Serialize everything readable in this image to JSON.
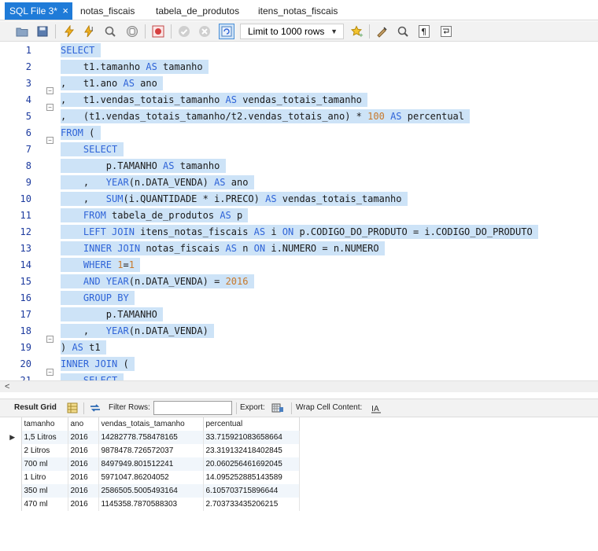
{
  "tabs": [
    {
      "label": "SQL File 3*",
      "close": "×"
    },
    {
      "label": "notas_fiscais"
    },
    {
      "label": "tabela_de_produtos"
    },
    {
      "label": "itens_notas_fiscais"
    }
  ],
  "toolbar": {
    "limit_label": "Limit to 1000 rows"
  },
  "editor": {
    "line_numbers": [
      "1",
      "2",
      "3",
      "4",
      "5",
      "6",
      "7",
      "8",
      "9",
      "10",
      "11",
      "12",
      "13",
      "14",
      "15",
      "16",
      "17",
      "18",
      "19",
      "20",
      "21"
    ]
  },
  "results_toolbar": {
    "result_grid": "Result Grid",
    "filter_rows": "Filter Rows:",
    "filter_value": "",
    "export": "Export:",
    "wrap": "Wrap Cell Content:"
  },
  "results": {
    "columns": [
      "tamanho",
      "ano",
      "vendas_totais_tamanho",
      "percentual"
    ],
    "rows": [
      [
        "1,5 Litros",
        "2016",
        "14282778.758478165",
        "33.715921083658664"
      ],
      [
        "2 Litros",
        "2016",
        "9878478.726572037",
        "23.319132418402845"
      ],
      [
        "700 ml",
        "2016",
        "8497949.801512241",
        "20.060256461692045"
      ],
      [
        "1 Litro",
        "2016",
        "5971047.86204052",
        "14.095252885143589"
      ],
      [
        "350 ml",
        "2016",
        "2586505.5005493164",
        "6.105703715896644"
      ],
      [
        "470 ml",
        "2016",
        "1145358.7870588303",
        "2.703733435206215"
      ]
    ]
  }
}
